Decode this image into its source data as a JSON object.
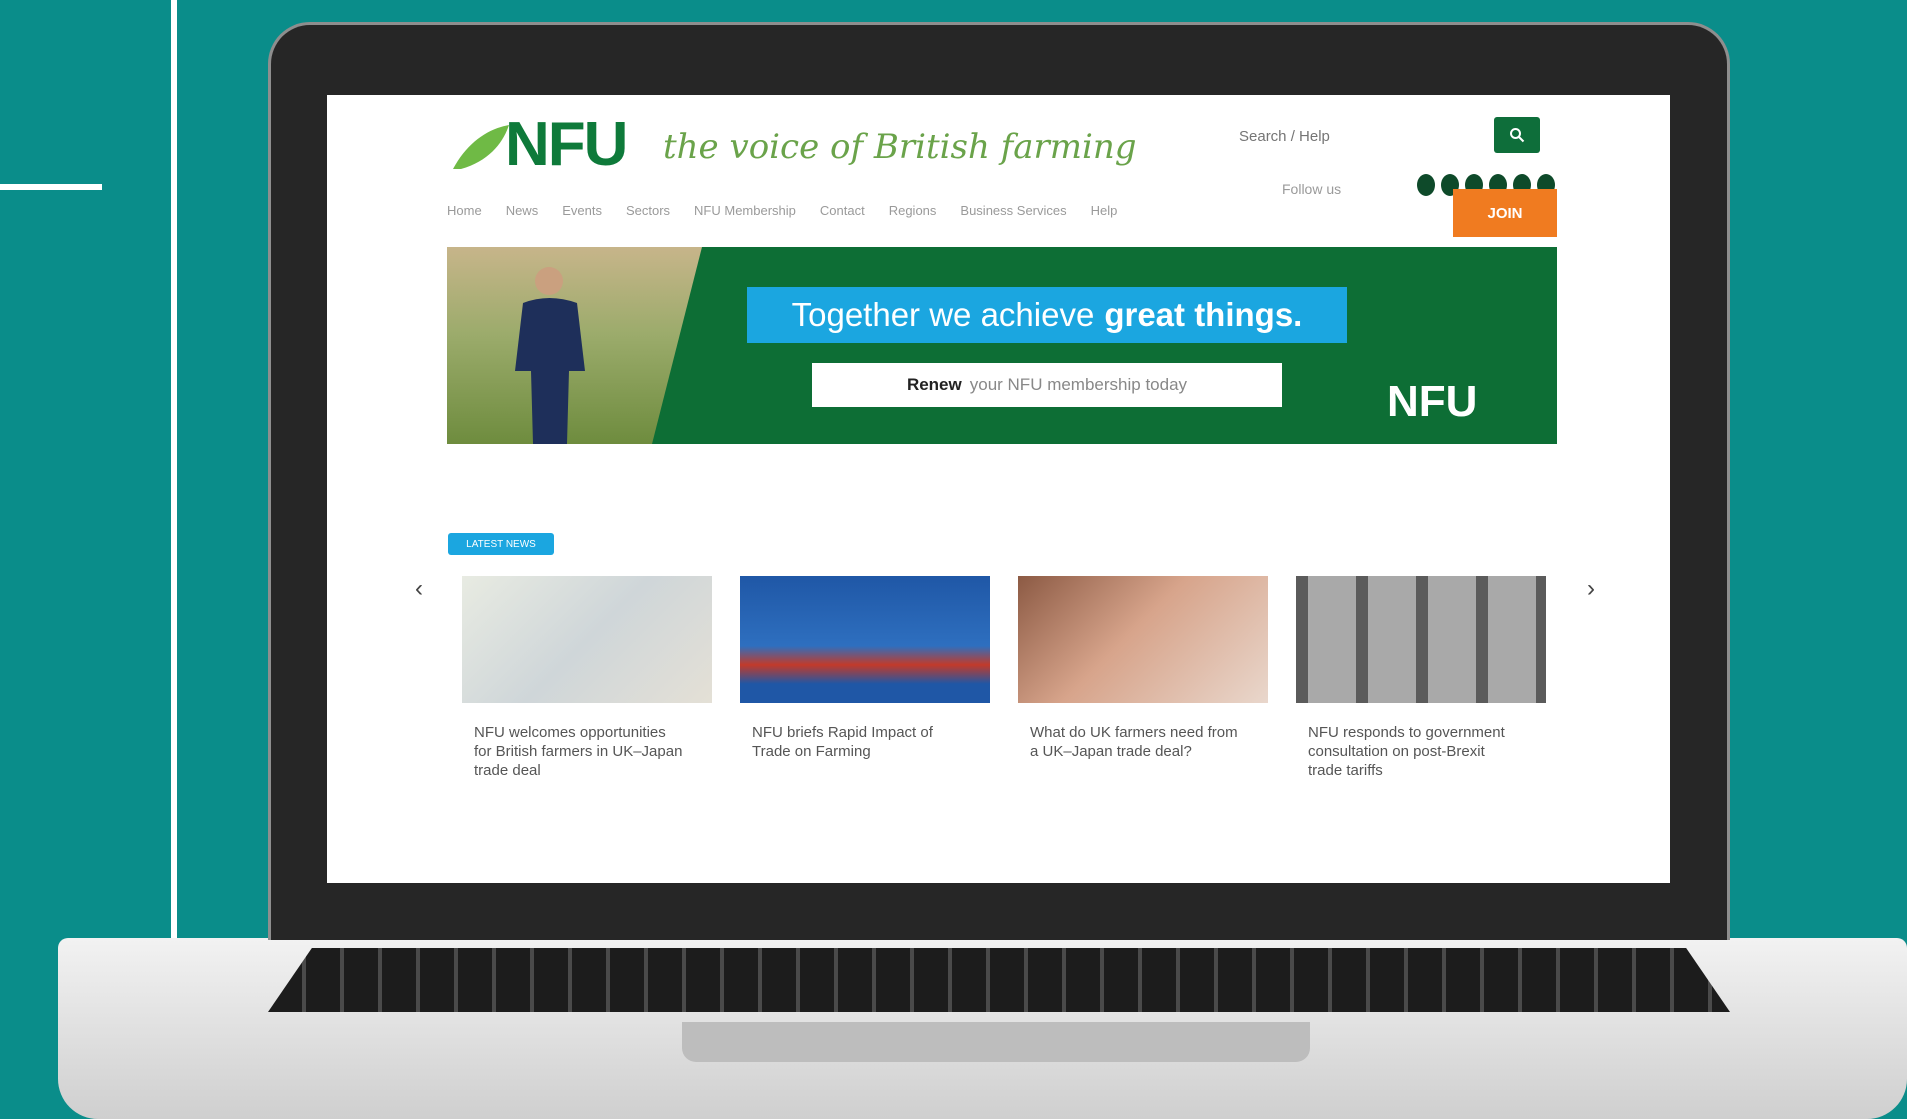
{
  "site": {
    "logo_text": "NFU",
    "tagline": "the voice of British farming",
    "search_placeholder": "Search / Help",
    "social_label": "Follow us",
    "join_button": "JOIN",
    "nav": [
      "Home",
      "News",
      "Events",
      "Sectors",
      "NFU Membership",
      "Contact",
      "Regions",
      "Business Services",
      "Help"
    ]
  },
  "banner": {
    "headline_prefix": "Together we achieve",
    "headline_bold": "great things.",
    "renew_bold": "Renew",
    "renew_rest": "your NFU membership today",
    "logo_text": "NFU"
  },
  "section_badge": "LATEST NEWS",
  "carousel": {
    "prev_arrow": "‹",
    "next_arrow": "›",
    "items": [
      {
        "title": "NFU welcomes opportunities for British farmers in UK–Japan trade deal"
      },
      {
        "title": "NFU briefs Rapid Impact of Trade on Farming"
      },
      {
        "title": "What do UK farmers need from a UK–Japan trade deal?"
      },
      {
        "title": "NFU responds to government consultation on post-Brexit trade tariffs"
      }
    ]
  },
  "colors": {
    "background": "#0a8d8a",
    "brand_green": "#0e7a3a",
    "accent_blue": "#1ba6e0",
    "join_orange": "#f07b20"
  }
}
